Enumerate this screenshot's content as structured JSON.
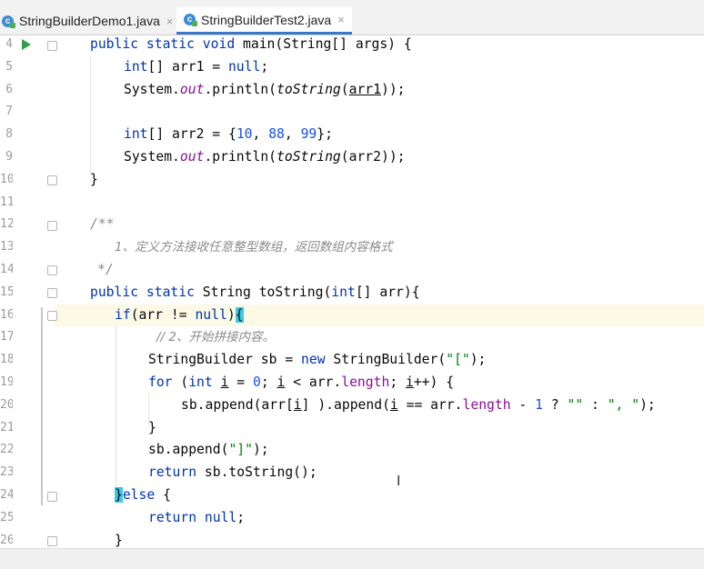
{
  "tabs": [
    {
      "label": "StringBuilderDemo1.java",
      "icon": "java-class-icon",
      "close": "×"
    },
    {
      "label": "StringBuilderTest2.java",
      "icon": "java-class-icon",
      "close": "×"
    }
  ],
  "editor": {
    "line_numbers": [
      "4",
      "5",
      "6",
      "7",
      "8",
      "9",
      "10",
      "11",
      "12",
      "13",
      "14",
      "15",
      "16",
      "17",
      "18",
      "19",
      "20",
      "21",
      "22",
      "23",
      "24",
      "25",
      "26"
    ],
    "current_line": "16",
    "lines": {
      "l4": {
        "a": "public static void ",
        "b": "main",
        "c": "(String[] args) {"
      },
      "l5": {
        "a": "int",
        "b": "[] arr1 = ",
        "c": "null",
        ";": ";"
      },
      "l6": {
        "a": "System.",
        "b": "out",
        "c": ".println(",
        "d": "toString",
        "e": "(",
        "f": "arr1",
        "g": "));"
      },
      "l8": {
        "a": "int",
        "b": "[] arr2 = {",
        "n1": "10",
        ",1": ", ",
        "n2": "88",
        ",2": ", ",
        "n3": "99",
        "end": "};"
      },
      "l9": {
        "a": "System.",
        "b": "out",
        "c": ".println(",
        "d": "toString",
        "e": "(arr2));"
      },
      "l10": {
        "a": "}"
      },
      "l12": {
        "a": "/**"
      },
      "l13": {
        "a": "1、定义方法接收任意整型数组，返回数组内容格式"
      },
      "l14": {
        "a": "*/"
      },
      "l15": {
        "a": "public static ",
        "b": "String ",
        "c": "toString",
        "d": "(",
        "e": "int",
        "f": "[] arr){"
      },
      "l16": {
        "a": "if",
        "b": "(arr != ",
        "c": "null",
        ")": ")",
        "brace": "{"
      },
      "l17": {
        "a": "// 2、开始拼接内容。"
      },
      "l18": {
        "a": "StringBuilder sb = ",
        "b": "new ",
        "c": "StringBuilder(",
        "d": "\"[\"",
        "e": ");"
      },
      "l19": {
        "a": "for ",
        "b": "(",
        "c": "int ",
        "d": "i",
        "e": " = ",
        "f": "0",
        "g": "; ",
        "h": "i",
        "i": " < arr.",
        "j": "length",
        "k": "; ",
        "l": "i",
        "m": "++) {"
      },
      "l20": {
        "a": "sb.append(arr[",
        "b": "i",
        "c": "] ).append(",
        "d": "i",
        "e": " == arr.",
        "f": "length",
        "g": " - ",
        "h": "1",
        "i": " ? ",
        "j": "\"\"",
        "k": " : ",
        "l": "\", \"",
        "m": ");"
      },
      "l21": {
        "a": "}"
      },
      "l22": {
        "a": "sb.append(",
        "b": "\"]\"",
        "c": ");"
      },
      "l23": {
        "a": "return ",
        "b": "sb.toString();"
      },
      "l24": {
        "brace": "}",
        "a": "else ",
        "b": "{"
      },
      "l25": {
        "a": "return ",
        "b": "null",
        ";": ";"
      },
      "l26": {
        "a": "}"
      }
    }
  },
  "cursor_glyph": "I",
  "colors": {
    "keyword": "#0033b3",
    "number": "#1750eb",
    "string": "#067d17",
    "field": "#871094",
    "comment": "#8c8c8c",
    "brace_match": "#3dc9e6",
    "tab_underline": "#3b78c8"
  }
}
